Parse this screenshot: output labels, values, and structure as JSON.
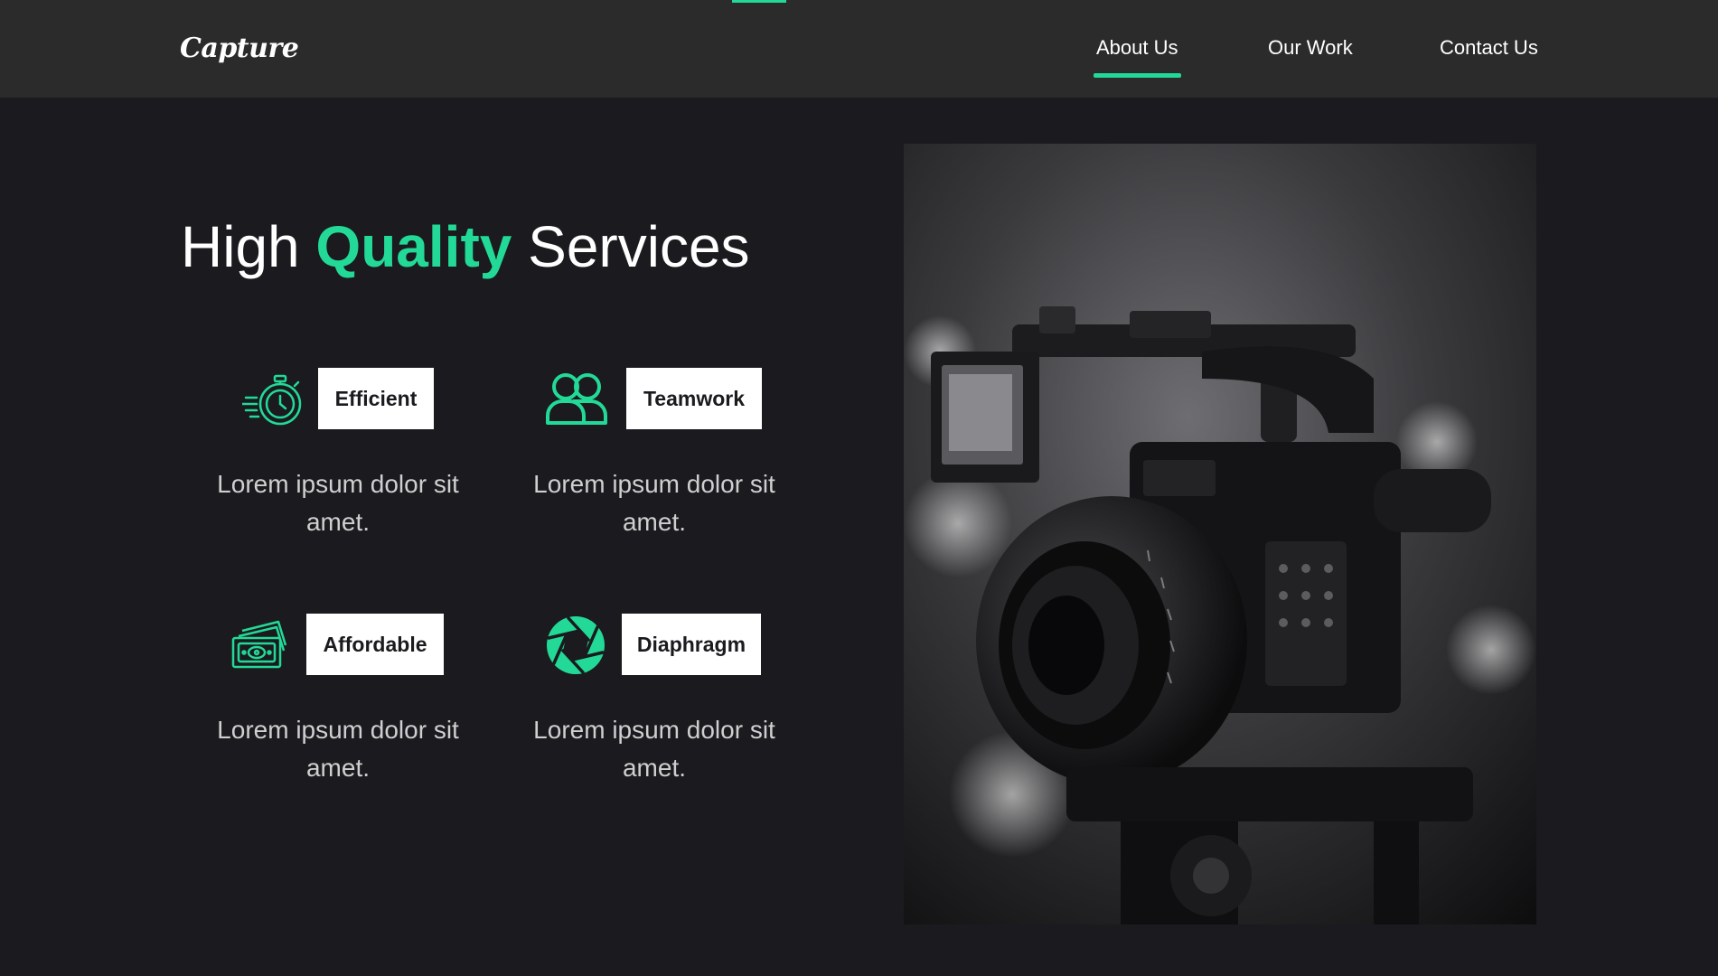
{
  "header": {
    "logo": "Capture",
    "nav": [
      {
        "label": "About Us",
        "active": true
      },
      {
        "label": "Our Work",
        "active": false
      },
      {
        "label": "Contact Us",
        "active": false
      }
    ]
  },
  "hero": {
    "title_before": "High",
    "title_accent": "Quality",
    "title_after": "Services"
  },
  "services": [
    {
      "label": "Efficient",
      "description": "Lorem ipsum dolor sit amet.",
      "icon": "stopwatch-icon"
    },
    {
      "label": "Teamwork",
      "description": "Lorem ipsum dolor sit amet.",
      "icon": "team-icon"
    },
    {
      "label": "Affordable",
      "description": "Lorem ipsum dolor sit amet.",
      "icon": "money-icon"
    },
    {
      "label": "Diaphragm",
      "description": "Lorem ipsum dolor sit amet.",
      "icon": "diaphragm-icon"
    }
  ],
  "colors": {
    "accent": "#23d997",
    "background": "#1b1a1e",
    "header": "#2b2b2b"
  },
  "image": {
    "subject": "camera-photo"
  }
}
